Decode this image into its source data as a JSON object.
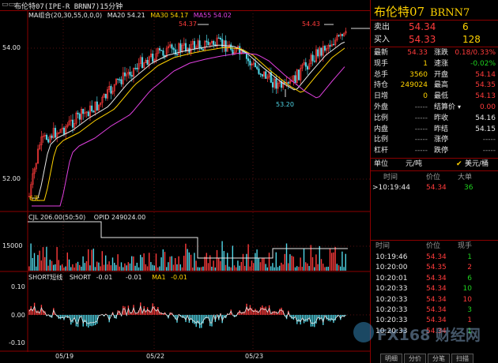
{
  "window": {
    "title": "布伦特07(IPE-R BRNN7)15分钟"
  },
  "main_chart": {
    "ma_label": "MA组合(20,30,55,0,0,0)",
    "ma20": "MA20 54.21",
    "ma30": "MA30 54.17",
    "ma55": "MA55 54.02",
    "y_ticks": [
      "54.00",
      "52.00"
    ],
    "annotations": {
      "high1": "54.37",
      "high2": "54.43",
      "low": "53.20",
      "start": "6天"
    }
  },
  "volume_chart": {
    "cjl": "CJL  206.00(50:50)",
    "opid": "OPID  249024.00",
    "y_tick": "15000"
  },
  "indicator_chart": {
    "title": "SHORT短线",
    "short_label": "SHORT",
    "short_val": "-0.01",
    "val2": "-0.01",
    "ma1_label": "MA1",
    "ma1_val": "-0.01",
    "y_ticks": [
      "0.10",
      "0.00",
      "-0.10"
    ]
  },
  "x_axis": [
    "05/19",
    "05/22",
    "05/23"
  ],
  "quote": {
    "name": "布伦特07",
    "code": "BRNN7",
    "sell_label": "卖出",
    "sell_price": "54.34",
    "sell_vol": "6",
    "buy_label": "买入",
    "buy_price": "54.33",
    "buy_vol": "128",
    "fields": [
      {
        "l1": "最新",
        "v1": "54.33",
        "c1": "red",
        "l2": "涨跌",
        "v2": "0.18/0.33%",
        "c2": "red"
      },
      {
        "l1": "现手",
        "v1": "1",
        "c1": "yellow",
        "l2": "速涨",
        "v2": "-0.02%",
        "c2": "green"
      },
      {
        "l1": "总手",
        "v1": "3560",
        "c1": "yellow",
        "l2": "开盘",
        "v2": "54.14",
        "c2": "red"
      },
      {
        "l1": "持仓",
        "v1": "249024",
        "c1": "yellow",
        "l2": "最高",
        "v2": "54.35",
        "c2": "red"
      },
      {
        "l1": "日增",
        "v1": "0",
        "c1": "yellow",
        "l2": "最低",
        "v2": "54.13",
        "c2": "red"
      },
      {
        "l1": "外盘",
        "v1": "-----",
        "c1": "grey",
        "l2": "结算价",
        "v2": "0.00",
        "c2": "red"
      },
      {
        "l1": "比例",
        "v1": "-----",
        "c1": "grey",
        "l2": "昨收",
        "v2": "54.16",
        "c2": "white"
      },
      {
        "l1": "内盘",
        "v1": "-----",
        "c1": "grey",
        "l2": "昨结",
        "v2": "54.15",
        "c2": "white"
      },
      {
        "l1": "比例",
        "v1": "-----",
        "c1": "grey",
        "l2": "涨停",
        "v2": "-----",
        "c2": "grey"
      },
      {
        "l1": "杠杆",
        "v1": "-----",
        "c1": "grey",
        "l2": "跌停",
        "v2": "-----",
        "c2": "grey"
      }
    ],
    "unit_label": "单位",
    "unit_value": "元/吨",
    "currency": "美元/桶"
  },
  "big_orders": {
    "headers": [
      "时间",
      "价位",
      "大单"
    ],
    "rows": [
      {
        "time": ">10:19:44",
        "price": "54.34",
        "vol": "36"
      }
    ]
  },
  "ticks": {
    "headers": [
      "时间",
      "价位",
      "现手"
    ],
    "rows": [
      {
        "time": "10:19:46",
        "price": "54.34",
        "vol": "1",
        "c": "green"
      },
      {
        "time": "10:20:00",
        "price": "54.35",
        "vol": "2",
        "c": "red"
      },
      {
        "time": "10:20:01",
        "price": "54.34",
        "vol": "6",
        "c": "green"
      },
      {
        "time": "10:20:33",
        "price": "54.34",
        "vol": "10",
        "c": "green"
      },
      {
        "time": "10:20:33",
        "price": "54.34",
        "vol": "10",
        "c": "red"
      },
      {
        "time": "10:20:33",
        "price": "54.34",
        "vol": "3",
        "c": "green"
      },
      {
        "time": "10:20:33",
        "price": "54.34",
        "vol": "1",
        "c": "red"
      },
      {
        "time": "10:20:33",
        "price": "54.34",
        "vol": "1",
        "c": "green"
      }
    ]
  },
  "bottom_tabs": [
    "明细",
    "分价",
    "分笔",
    "扫描"
  ],
  "watermark": "FX168 财经网"
}
